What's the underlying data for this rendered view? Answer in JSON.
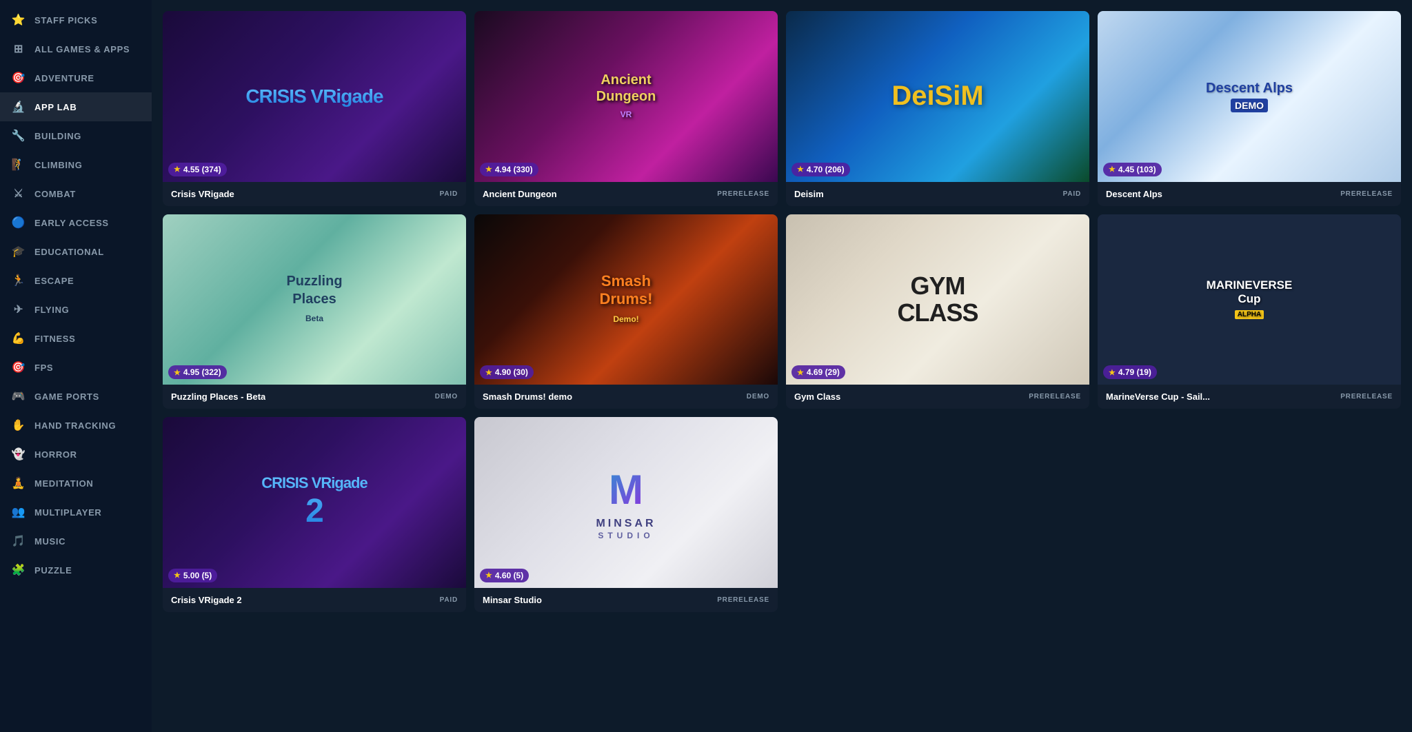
{
  "sidebar": {
    "items": [
      {
        "id": "staff-picks",
        "label": "STAFF PICKS",
        "icon": "⭐",
        "active": false
      },
      {
        "id": "all-games",
        "label": "ALL GAMES & APPS",
        "icon": "⊞",
        "active": false
      },
      {
        "id": "adventure",
        "label": "ADVENTURE",
        "icon": "🎯",
        "active": false
      },
      {
        "id": "app-lab",
        "label": "APP LAB",
        "icon": "🔬",
        "active": true
      },
      {
        "id": "building",
        "label": "BUILDING",
        "icon": "🔧",
        "active": false
      },
      {
        "id": "climbing",
        "label": "CLIMBING",
        "icon": "🧗",
        "active": false
      },
      {
        "id": "combat",
        "label": "COMBAT",
        "icon": "⚔",
        "active": false
      },
      {
        "id": "early-access",
        "label": "EARLY ACCESS",
        "icon": "🔵",
        "active": false
      },
      {
        "id": "educational",
        "label": "EDUCATIONAL",
        "icon": "🎓",
        "active": false
      },
      {
        "id": "escape",
        "label": "ESCAPE",
        "icon": "🏃",
        "active": false
      },
      {
        "id": "flying",
        "label": "FLYING",
        "icon": "✈",
        "active": false
      },
      {
        "id": "fitness",
        "label": "FITNESS",
        "icon": "💪",
        "active": false
      },
      {
        "id": "fps",
        "label": "FPS",
        "icon": "🎯",
        "active": false
      },
      {
        "id": "game-ports",
        "label": "GAME PORTS",
        "icon": "🎮",
        "active": false
      },
      {
        "id": "hand-tracking",
        "label": "HAND TRACKING",
        "icon": "✋",
        "active": false
      },
      {
        "id": "horror",
        "label": "HORROR",
        "icon": "👻",
        "active": false
      },
      {
        "id": "meditation",
        "label": "MEDITATION",
        "icon": "🧘",
        "active": false
      },
      {
        "id": "multiplayer",
        "label": "MULTIPLAYER",
        "icon": "👥",
        "active": false
      },
      {
        "id": "music",
        "label": "MUSIC",
        "icon": "🎵",
        "active": false
      },
      {
        "id": "puzzle",
        "label": "PUZZLE",
        "icon": "🧩",
        "active": false
      }
    ]
  },
  "games": [
    {
      "id": "crisis-vrigade",
      "title": "Crisis VRigade",
      "rating": "4.55",
      "review_count": "374",
      "tag": "PAID",
      "image_class": "img-crisis-vrigade",
      "image_text_type": "crisis"
    },
    {
      "id": "ancient-dungeon",
      "title": "Ancient Dungeon",
      "rating": "4.94",
      "review_count": "330",
      "tag": "PRERELEASE",
      "image_class": "img-ancient-dungeon",
      "image_text_type": "ancient"
    },
    {
      "id": "deisim",
      "title": "Deisim",
      "rating": "4.70",
      "review_count": "206",
      "tag": "PAID",
      "image_class": "img-deisim",
      "image_text_type": "deisim"
    },
    {
      "id": "descent-alps",
      "title": "Descent Alps",
      "rating": "4.45",
      "review_count": "103",
      "tag": "PRERELEASE",
      "image_class": "img-descent-alps",
      "image_text_type": "descent"
    },
    {
      "id": "puzzling-places",
      "title": "Puzzling Places - Beta",
      "rating": "4.95",
      "review_count": "322",
      "tag": "DEMO",
      "image_class": "img-puzzling-places",
      "image_text_type": "puzzling"
    },
    {
      "id": "smash-drums",
      "title": "Smash Drums! demo",
      "rating": "4.90",
      "review_count": "30",
      "tag": "DEMO",
      "image_class": "img-smash-drums",
      "image_text_type": "smash"
    },
    {
      "id": "gym-class",
      "title": "Gym Class",
      "rating": "4.69",
      "review_count": "29",
      "tag": "PRERELEASE",
      "image_class": "img-gym-class",
      "image_text_type": "gym"
    },
    {
      "id": "marineverse",
      "title": "MarineVerse Cup - Sail...",
      "rating": "4.79",
      "review_count": "19",
      "tag": "PRERELEASE",
      "image_class": "img-marineverse",
      "image_text_type": "marine"
    },
    {
      "id": "crisis-vrigade2",
      "title": "Crisis VRigade 2",
      "rating": "5.00",
      "review_count": "5",
      "tag": "PAID",
      "image_class": "img-crisis-vrigade2",
      "image_text_type": "crisis2"
    },
    {
      "id": "minsar-studio",
      "title": "Minsar Studio",
      "rating": "4.60",
      "review_count": "5",
      "tag": "PRERELEASE",
      "image_class": "img-minsar",
      "image_text_type": "minsar"
    }
  ]
}
